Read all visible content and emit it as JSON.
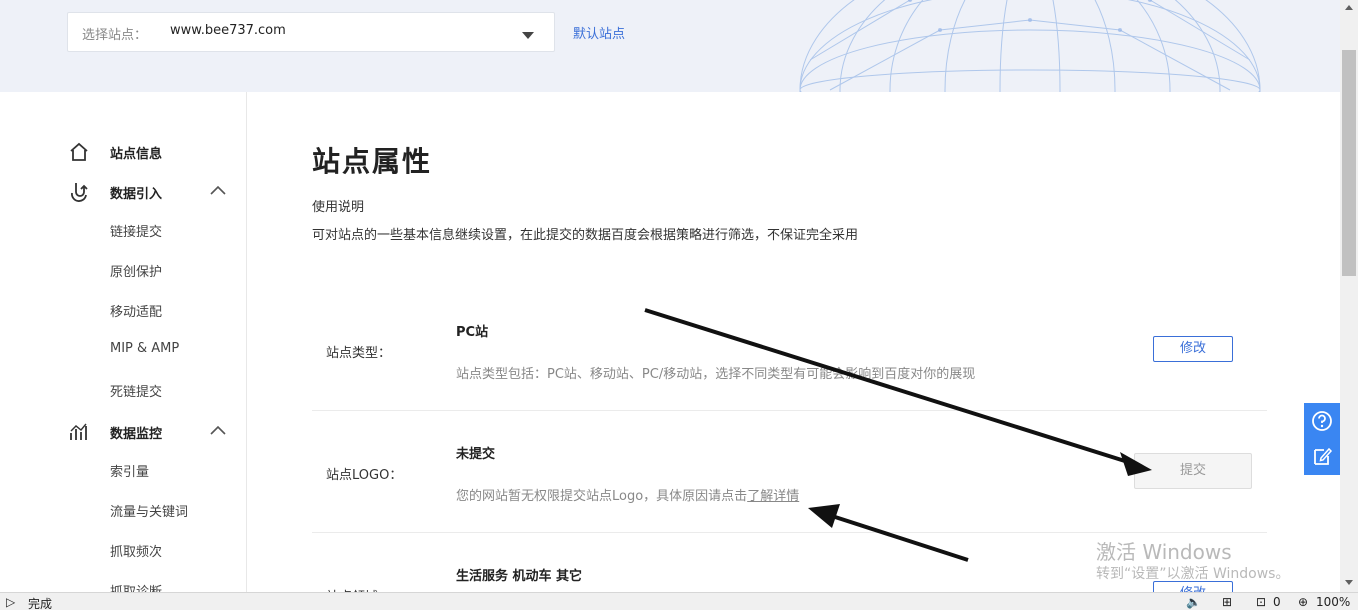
{
  "site_selector": {
    "label": "选择站点：",
    "value": "www.bee737.com",
    "default_link": "默认站点"
  },
  "sidebar": {
    "groups": [
      {
        "label": "站点信息",
        "icon": "home-icon"
      },
      {
        "label": "数据引入",
        "icon": "data-import-icon",
        "expanded": true,
        "items": [
          "链接提交",
          "原创保护",
          "移动适配",
          "MIP & AMP",
          "死链提交"
        ]
      },
      {
        "label": "数据监控",
        "icon": "chart-icon",
        "expanded": true,
        "items": [
          "索引量",
          "流量与关键词",
          "抓取频次",
          "抓取诊断"
        ]
      }
    ]
  },
  "main": {
    "title": "站点属性",
    "usage_title": "使用说明",
    "usage_desc": "可对站点的一些基本信息继续设置，在此提交的数据百度会根据策略进行筛选，不保证完全采用",
    "rows": [
      {
        "label": "站点类型：",
        "title": "PC站",
        "desc": "站点类型包括：PC站、移动站、PC/移动站，选择不同类型有可能会影响到百度对你的展现",
        "button": "修改"
      },
      {
        "label": "站点LOGO：",
        "title": "未提交",
        "desc_prefix": "您的网站暂无权限提交站点Logo，具体原因请点击",
        "desc_link": "了解详情",
        "button": "提交"
      },
      {
        "label": "站点领域：",
        "title": "生活服务 机动车 其它",
        "button": "修改"
      }
    ]
  },
  "watermark": {
    "line1": "激活 Windows",
    "line2": "转到“设置”以激活 Windows。"
  },
  "statusbar": {
    "status": "完成",
    "count": "0",
    "zoom": "100%"
  },
  "colors": {
    "accent": "#3a6fd8",
    "float_bg": "#3a86f2",
    "banner_bg": "#eef1f8"
  }
}
